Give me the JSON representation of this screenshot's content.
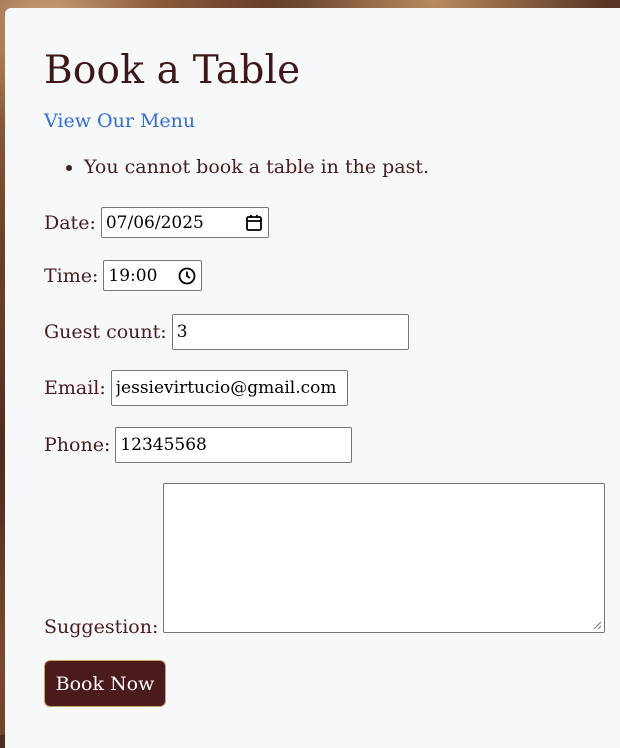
{
  "page": {
    "title": "Book a Table",
    "menu_link": "View Our Menu"
  },
  "errors": [
    "You cannot book a table in the past."
  ],
  "form": {
    "date": {
      "label": "Date:",
      "value": "07/06/2025"
    },
    "time": {
      "label": "Time:",
      "value": "19:00"
    },
    "guests": {
      "label": "Guest count:",
      "value": "3"
    },
    "email": {
      "label": "Email:",
      "value": "jessievirtucio@gmail.com"
    },
    "phone": {
      "label": "Phone:",
      "value": "12345568"
    },
    "suggestion": {
      "label": "Suggestion:",
      "value": ""
    },
    "submit_label": "Book Now"
  },
  "icons": {
    "date": "calendar-icon",
    "time": "clock-icon",
    "resize": "resize-grip-icon"
  },
  "colors": {
    "title": "#3f1717",
    "link": "#2f6fd6",
    "button_bg": "#4b1a1a",
    "button_border": "#c7a46a",
    "card_bg": "#f7f8fa"
  }
}
